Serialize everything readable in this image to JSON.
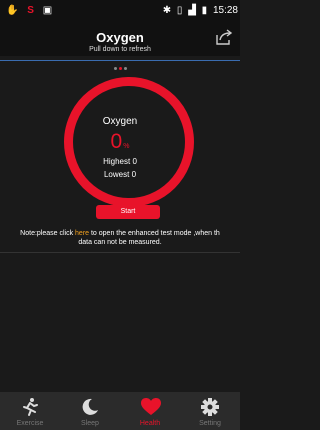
{
  "status_bar": {
    "left_icons": [
      "hand-icon",
      "s-icon",
      "image-icon"
    ],
    "right_icons": [
      "bluetooth-icon",
      "vibrate-icon",
      "signal-icon",
      "battery-icon"
    ],
    "time": "15:28"
  },
  "header": {
    "title": "Oxygen",
    "subtitle": "Pull down to refresh"
  },
  "page_indicator": {
    "count": 3,
    "active_index": 1
  },
  "gauge": {
    "label": "Oxygen",
    "value": "0",
    "unit": "%",
    "highest_label": "Highest",
    "highest_value": "0",
    "lowest_label": "Lowest",
    "lowest_value": "0"
  },
  "start_button": "Start",
  "note": {
    "prefix": "Note:please click ",
    "link": "here",
    "suffix": " to open the enhanced test mode ,when th",
    "line2": "data can not be measured."
  },
  "tabs": [
    {
      "label": "Exercise",
      "icon": "running-icon",
      "active": false
    },
    {
      "label": "Sleep",
      "icon": "moon-icon",
      "active": false
    },
    {
      "label": "Health",
      "icon": "heart-icon",
      "active": true
    },
    {
      "label": "Setting",
      "icon": "gear-icon",
      "active": false
    }
  ],
  "colors": {
    "accent": "#e8132a",
    "background": "#1a1a1a",
    "tabbar": "#2b2b2b",
    "link": "#f0a020"
  }
}
